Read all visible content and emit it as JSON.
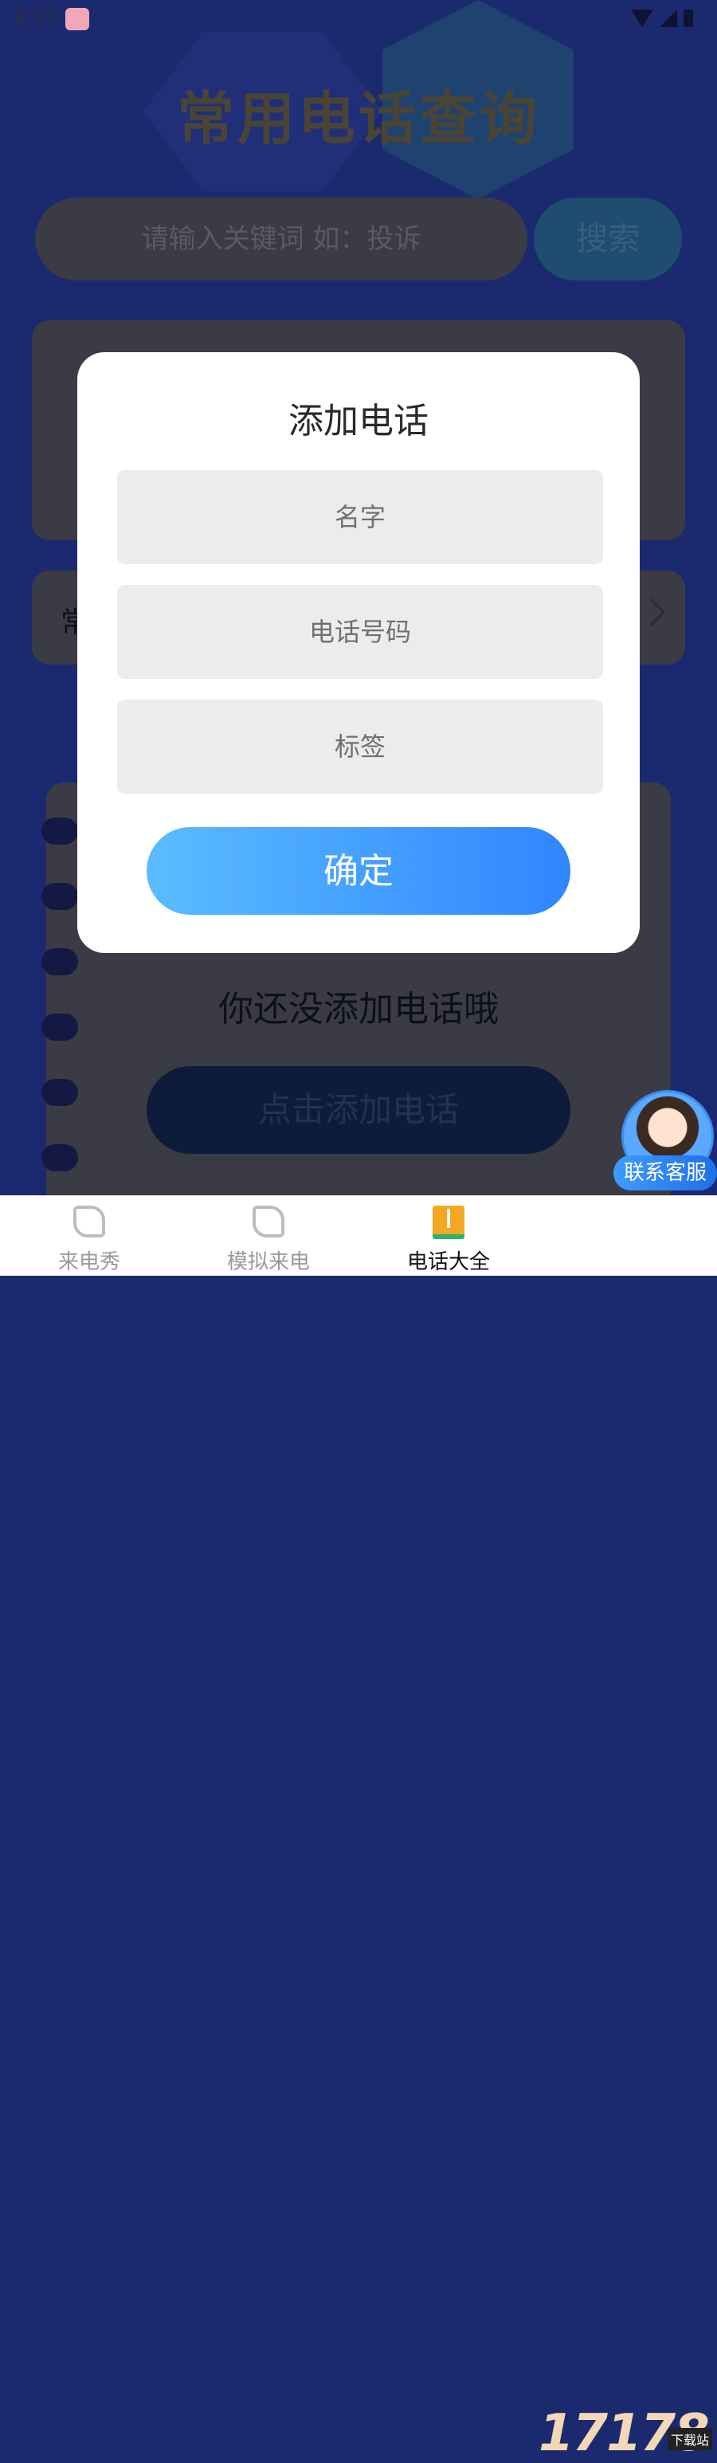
{
  "status_bar": {
    "time": "8:57"
  },
  "page": {
    "title": "常用电话查询",
    "search_placeholder": "请输入关键词 如：投诉",
    "search_button": "搜索",
    "list_card_text": "常",
    "empty_text": "你还没添加电话哦",
    "add_phone_button": "点击添加电话"
  },
  "dialog": {
    "title": "添加电话",
    "name_placeholder": "名字",
    "phone_placeholder": "电话号码",
    "tag_placeholder": "标签",
    "confirm_button": "确定"
  },
  "customer_service": {
    "label": "联系客服"
  },
  "bottom_nav": {
    "items": [
      {
        "label": "来电秀",
        "icon": "phone-callback-icon",
        "active": false
      },
      {
        "label": "模拟来电",
        "icon": "phone-callback-icon",
        "active": false
      },
      {
        "label": "电话大全",
        "icon": "book-icon",
        "active": true
      }
    ]
  },
  "watermark": {
    "text": "17178",
    "badge": "下载站"
  }
}
